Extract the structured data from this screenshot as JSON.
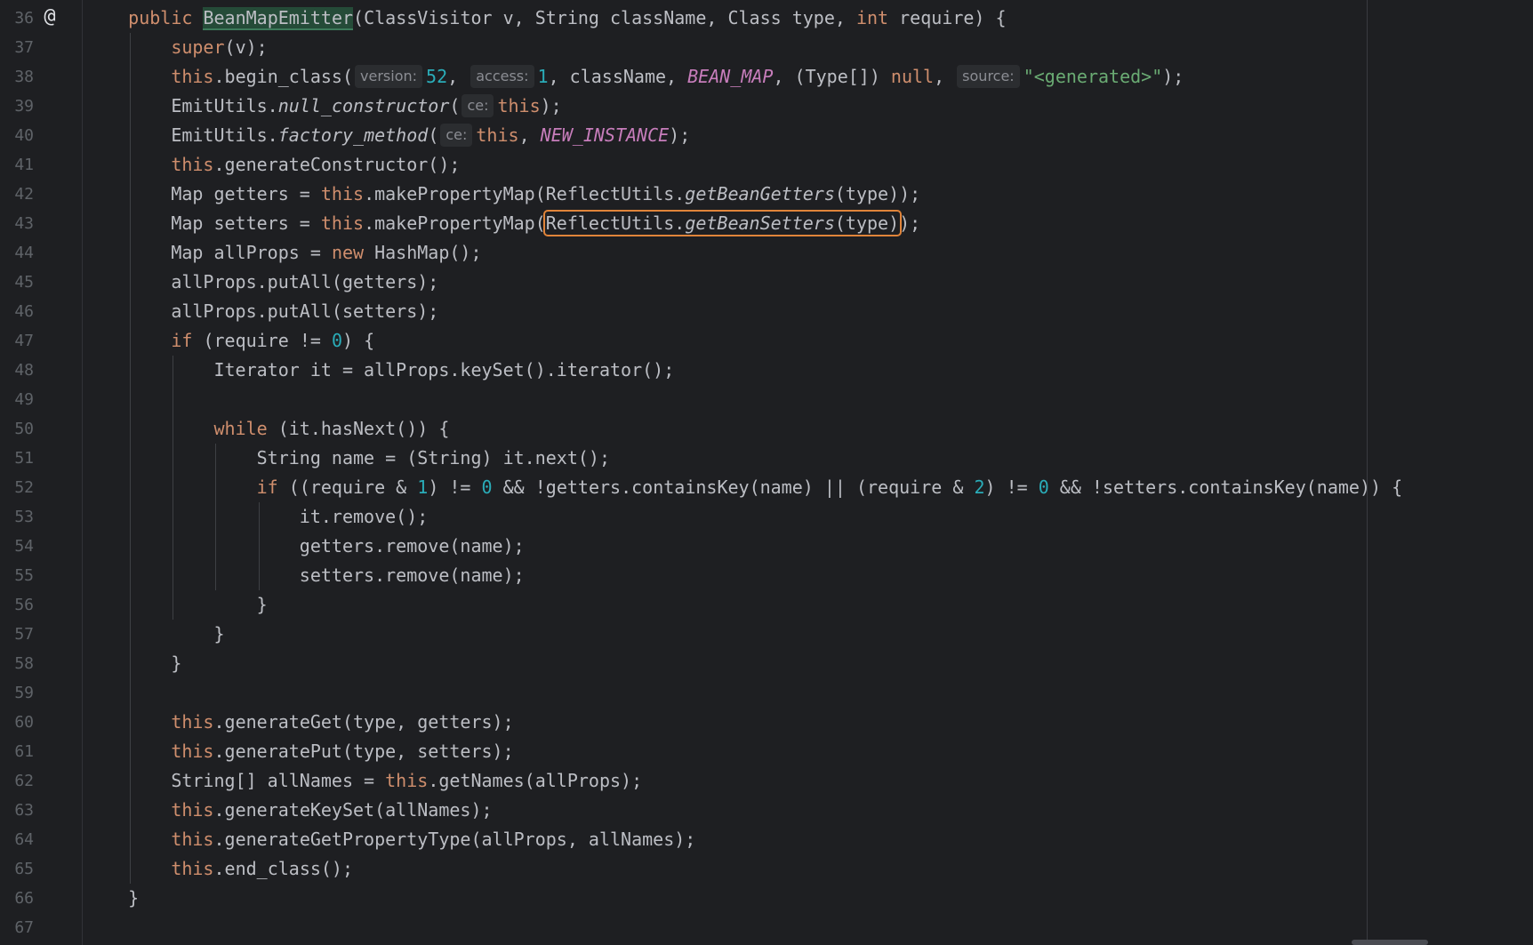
{
  "editor": {
    "gutter_icon": "@",
    "gutter_icon_name": "override-annotation-icon",
    "colors": {
      "background": "#1e1f22",
      "keyword": "#cf8e6d",
      "number": "#2aacb8",
      "string": "#6aab73",
      "constant": "#c77dbb",
      "text": "#bcbec4",
      "highlight_box": "#e0843a"
    },
    "lines": [
      {
        "num": "36",
        "indent": 1,
        "parts": [
          [
            "kw",
            "public"
          ],
          [
            "t",
            " "
          ],
          [
            "hl",
            "BeanMapEmitter"
          ],
          [
            "t",
            "(ClassVisitor v, String className, Class type, "
          ],
          [
            "kw",
            "int"
          ],
          [
            "t",
            " require) {"
          ]
        ]
      },
      {
        "num": "37",
        "indent": 2,
        "parts": [
          [
            "kw",
            "super"
          ],
          [
            "t",
            "(v);"
          ]
        ]
      },
      {
        "num": "38",
        "indent": 2,
        "parts": [
          [
            "kw",
            "this"
          ],
          [
            "t",
            ".begin_class("
          ],
          [
            "hint",
            "version:"
          ],
          [
            "num",
            "52"
          ],
          [
            "t",
            ", "
          ],
          [
            "hint",
            "access:"
          ],
          [
            "num",
            "1"
          ],
          [
            "t",
            ", className, "
          ],
          [
            "const",
            "BEAN_MAP"
          ],
          [
            "t",
            ", (Type[]) "
          ],
          [
            "kw",
            "null"
          ],
          [
            "t",
            ", "
          ],
          [
            "hint",
            "source:"
          ],
          [
            "str",
            "\"<generated>\""
          ],
          [
            "t",
            ");"
          ]
        ]
      },
      {
        "num": "39",
        "indent": 2,
        "parts": [
          [
            "t",
            "EmitUtils."
          ],
          [
            "sm",
            "null_constructor"
          ],
          [
            "t",
            "("
          ],
          [
            "hint",
            "ce:"
          ],
          [
            "kw",
            "this"
          ],
          [
            "t",
            ");"
          ]
        ]
      },
      {
        "num": "40",
        "indent": 2,
        "parts": [
          [
            "t",
            "EmitUtils."
          ],
          [
            "sm",
            "factory_method"
          ],
          [
            "t",
            "("
          ],
          [
            "hint",
            "ce:"
          ],
          [
            "kw",
            "this"
          ],
          [
            "t",
            ", "
          ],
          [
            "const",
            "NEW_INSTANCE"
          ],
          [
            "t",
            ");"
          ]
        ]
      },
      {
        "num": "41",
        "indent": 2,
        "parts": [
          [
            "kw",
            "this"
          ],
          [
            "t",
            ".generateConstructor();"
          ]
        ]
      },
      {
        "num": "42",
        "indent": 2,
        "parts": [
          [
            "t",
            "Map getters = "
          ],
          [
            "kw",
            "this"
          ],
          [
            "t",
            ".makePropertyMap(ReflectUtils."
          ],
          [
            "sm",
            "getBeanGetters"
          ],
          [
            "t",
            "(type));"
          ]
        ]
      },
      {
        "num": "43",
        "indent": 2,
        "parts": [
          [
            "t",
            "Map setters = "
          ],
          [
            "kw",
            "this"
          ],
          [
            "t",
            ".makePropertyMap("
          ],
          [
            "box_start",
            ""
          ],
          [
            "t",
            "ReflectUtils."
          ],
          [
            "sm",
            "getBeanSetters"
          ],
          [
            "t",
            "(type)"
          ],
          [
            "box_end",
            ""
          ],
          [
            "t",
            ");"
          ]
        ]
      },
      {
        "num": "44",
        "indent": 2,
        "parts": [
          [
            "t",
            "Map allProps = "
          ],
          [
            "kw",
            "new"
          ],
          [
            "t",
            " HashMap();"
          ]
        ]
      },
      {
        "num": "45",
        "indent": 2,
        "parts": [
          [
            "t",
            "allProps.putAll(getters);"
          ]
        ]
      },
      {
        "num": "46",
        "indent": 2,
        "parts": [
          [
            "t",
            "allProps.putAll(setters);"
          ]
        ]
      },
      {
        "num": "47",
        "indent": 2,
        "parts": [
          [
            "kw",
            "if"
          ],
          [
            "t",
            " (require != "
          ],
          [
            "num",
            "0"
          ],
          [
            "t",
            ") {"
          ]
        ]
      },
      {
        "num": "48",
        "indent": 3,
        "parts": [
          [
            "t",
            "Iterator it = allProps.keySet().iterator();"
          ]
        ]
      },
      {
        "num": "49",
        "indent": 3,
        "parts": []
      },
      {
        "num": "50",
        "indent": 3,
        "parts": [
          [
            "kw",
            "while"
          ],
          [
            "t",
            " (it.hasNext()) {"
          ]
        ]
      },
      {
        "num": "51",
        "indent": 4,
        "parts": [
          [
            "t",
            "String name = (String) it.next();"
          ]
        ]
      },
      {
        "num": "52",
        "indent": 4,
        "parts": [
          [
            "kw",
            "if"
          ],
          [
            "t",
            " ((require & "
          ],
          [
            "num",
            "1"
          ],
          [
            "t",
            ") != "
          ],
          [
            "num",
            "0"
          ],
          [
            "t",
            " && !getters.containsKey(name) || (require & "
          ],
          [
            "num",
            "2"
          ],
          [
            "t",
            ") != "
          ],
          [
            "num",
            "0"
          ],
          [
            "t",
            " && !setters.containsKey(name)) {"
          ]
        ]
      },
      {
        "num": "53",
        "indent": 5,
        "parts": [
          [
            "t",
            "it.remove();"
          ]
        ]
      },
      {
        "num": "54",
        "indent": 5,
        "parts": [
          [
            "t",
            "getters.remove(name);"
          ]
        ]
      },
      {
        "num": "55",
        "indent": 5,
        "parts": [
          [
            "t",
            "setters.remove(name);"
          ]
        ]
      },
      {
        "num": "56",
        "indent": 4,
        "parts": [
          [
            "t",
            "}"
          ]
        ]
      },
      {
        "num": "57",
        "indent": 3,
        "parts": [
          [
            "t",
            "}"
          ]
        ]
      },
      {
        "num": "58",
        "indent": 2,
        "parts": [
          [
            "t",
            "}"
          ]
        ]
      },
      {
        "num": "59",
        "indent": 2,
        "parts": []
      },
      {
        "num": "60",
        "indent": 2,
        "parts": [
          [
            "kw",
            "this"
          ],
          [
            "t",
            ".generateGet(type, getters);"
          ]
        ]
      },
      {
        "num": "61",
        "indent": 2,
        "parts": [
          [
            "kw",
            "this"
          ],
          [
            "t",
            ".generatePut(type, setters);"
          ]
        ]
      },
      {
        "num": "62",
        "indent": 2,
        "parts": [
          [
            "t",
            "String[] allNames = "
          ],
          [
            "kw",
            "this"
          ],
          [
            "t",
            ".getNames(allProps);"
          ]
        ]
      },
      {
        "num": "63",
        "indent": 2,
        "parts": [
          [
            "kw",
            "this"
          ],
          [
            "t",
            ".generateKeySet(allNames);"
          ]
        ]
      },
      {
        "num": "64",
        "indent": 2,
        "parts": [
          [
            "kw",
            "this"
          ],
          [
            "t",
            ".generateGetPropertyType(allProps, allNames);"
          ]
        ]
      },
      {
        "num": "65",
        "indent": 2,
        "parts": [
          [
            "kw",
            "this"
          ],
          [
            "t",
            ".end_class();"
          ]
        ]
      },
      {
        "num": "66",
        "indent": 1,
        "parts": [
          [
            "t",
            "}"
          ]
        ]
      },
      {
        "num": "67",
        "indent": 1,
        "parts": []
      }
    ]
  }
}
